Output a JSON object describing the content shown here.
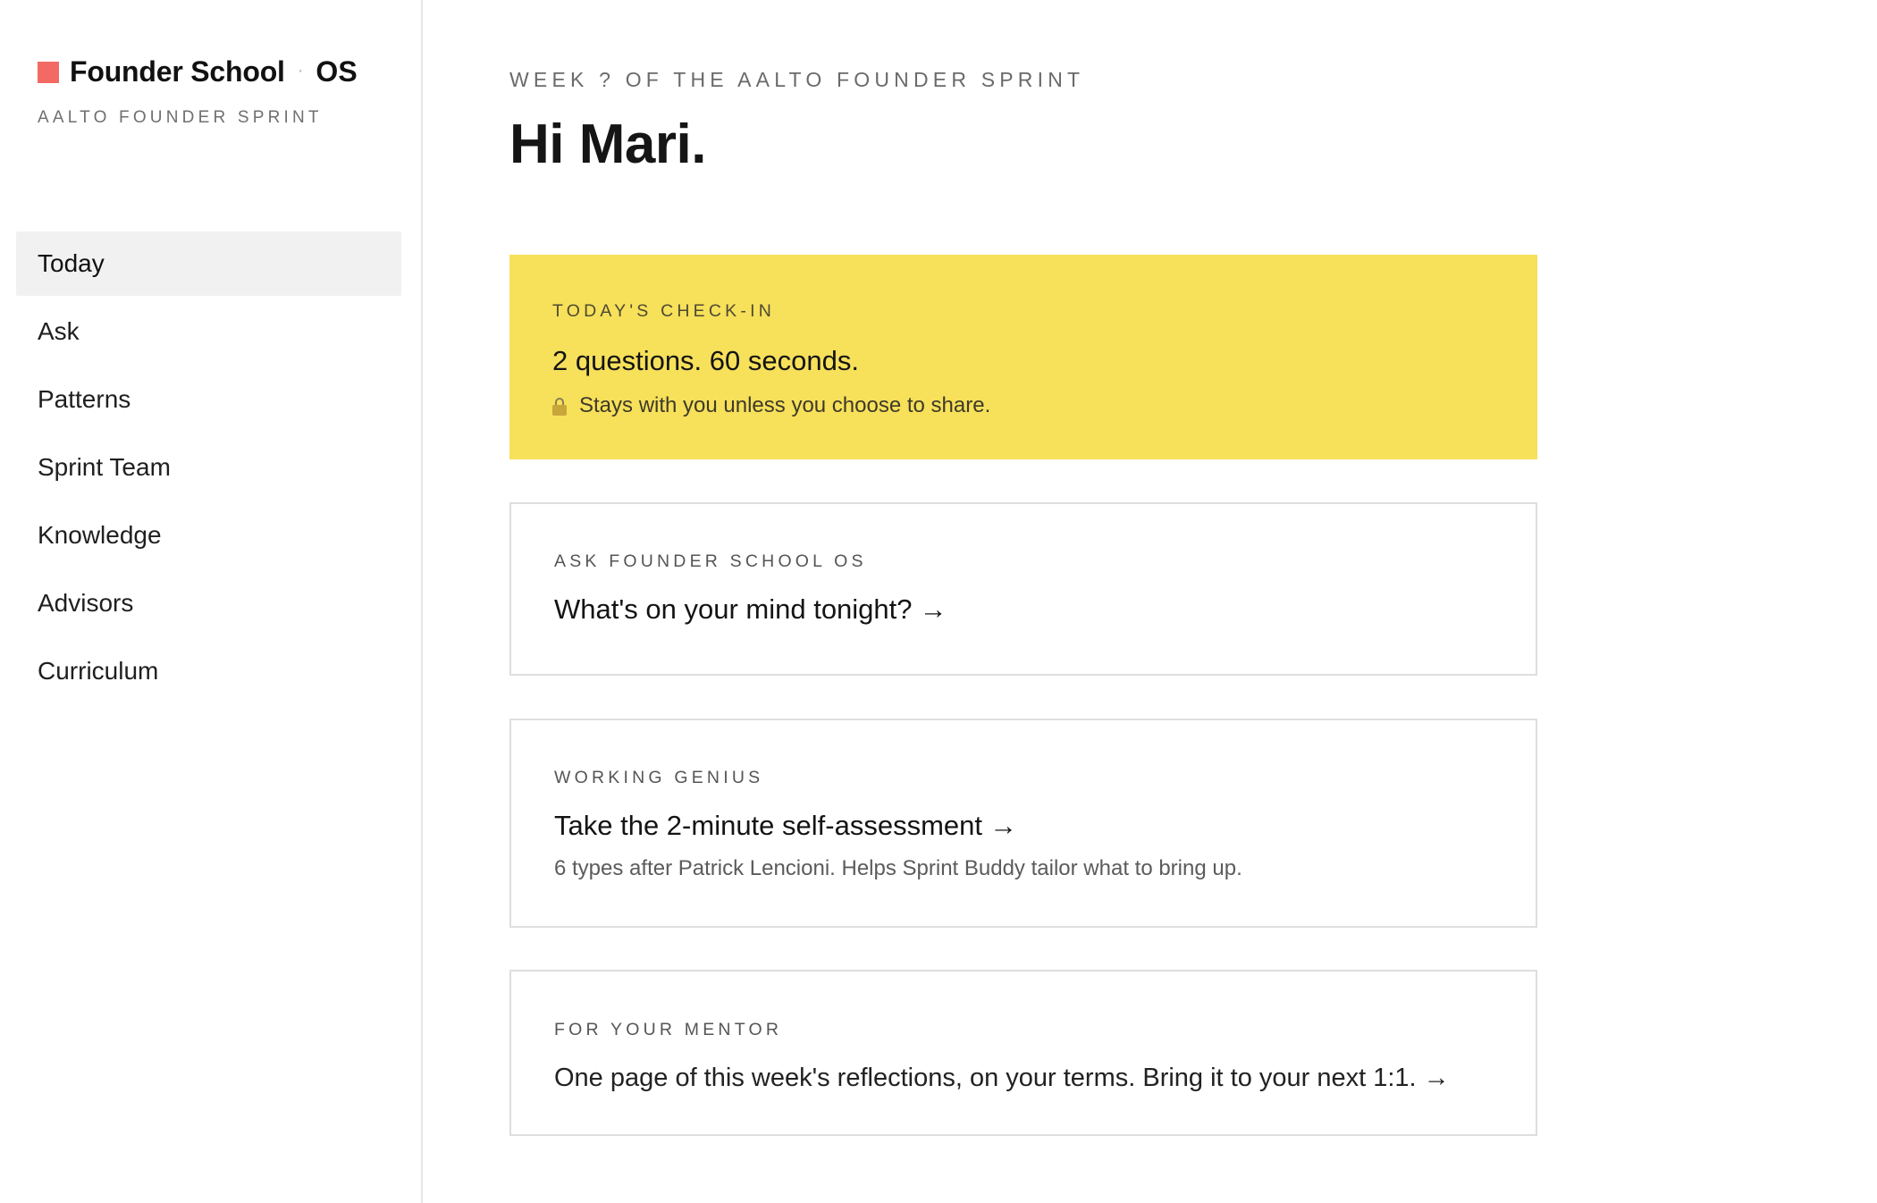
{
  "brand": {
    "name": "Founder School",
    "separator": "·",
    "suffix": "OS",
    "subtitle": "AALTO FOUNDER SPRINT",
    "accent_color": "#f26a63"
  },
  "nav": {
    "active": "Today",
    "items": [
      {
        "label": "Today"
      },
      {
        "label": "Ask"
      },
      {
        "label": "Patterns"
      },
      {
        "label": "Sprint Team"
      },
      {
        "label": "Knowledge"
      },
      {
        "label": "Advisors"
      },
      {
        "label": "Curriculum"
      }
    ]
  },
  "header": {
    "eyebrow": "WEEK ? OF THE AALTO FOUNDER SPRINT",
    "greeting": "Hi Mari."
  },
  "cards": {
    "checkin": {
      "label": "TODAY'S CHECK-IN",
      "title": "2 questions. 60 seconds.",
      "note": "Stays with you unless you choose to share.",
      "note_icon": "lock-icon",
      "background": "#f7e05a"
    },
    "ask": {
      "label": "ASK FOUNDER SCHOOL OS",
      "title": "What's on your mind tonight?",
      "arrow": "→"
    },
    "genius": {
      "label": "WORKING GENIUS",
      "title": "Take the 2-minute self-assessment",
      "arrow": "→",
      "description": "6 types after Patrick Lencioni. Helps Sprint Buddy tailor what to bring up."
    },
    "mentor": {
      "label": "FOR YOUR MENTOR",
      "title": "One page of this week's reflections, on your terms. Bring it to your next 1:1.",
      "arrow": "→"
    }
  }
}
